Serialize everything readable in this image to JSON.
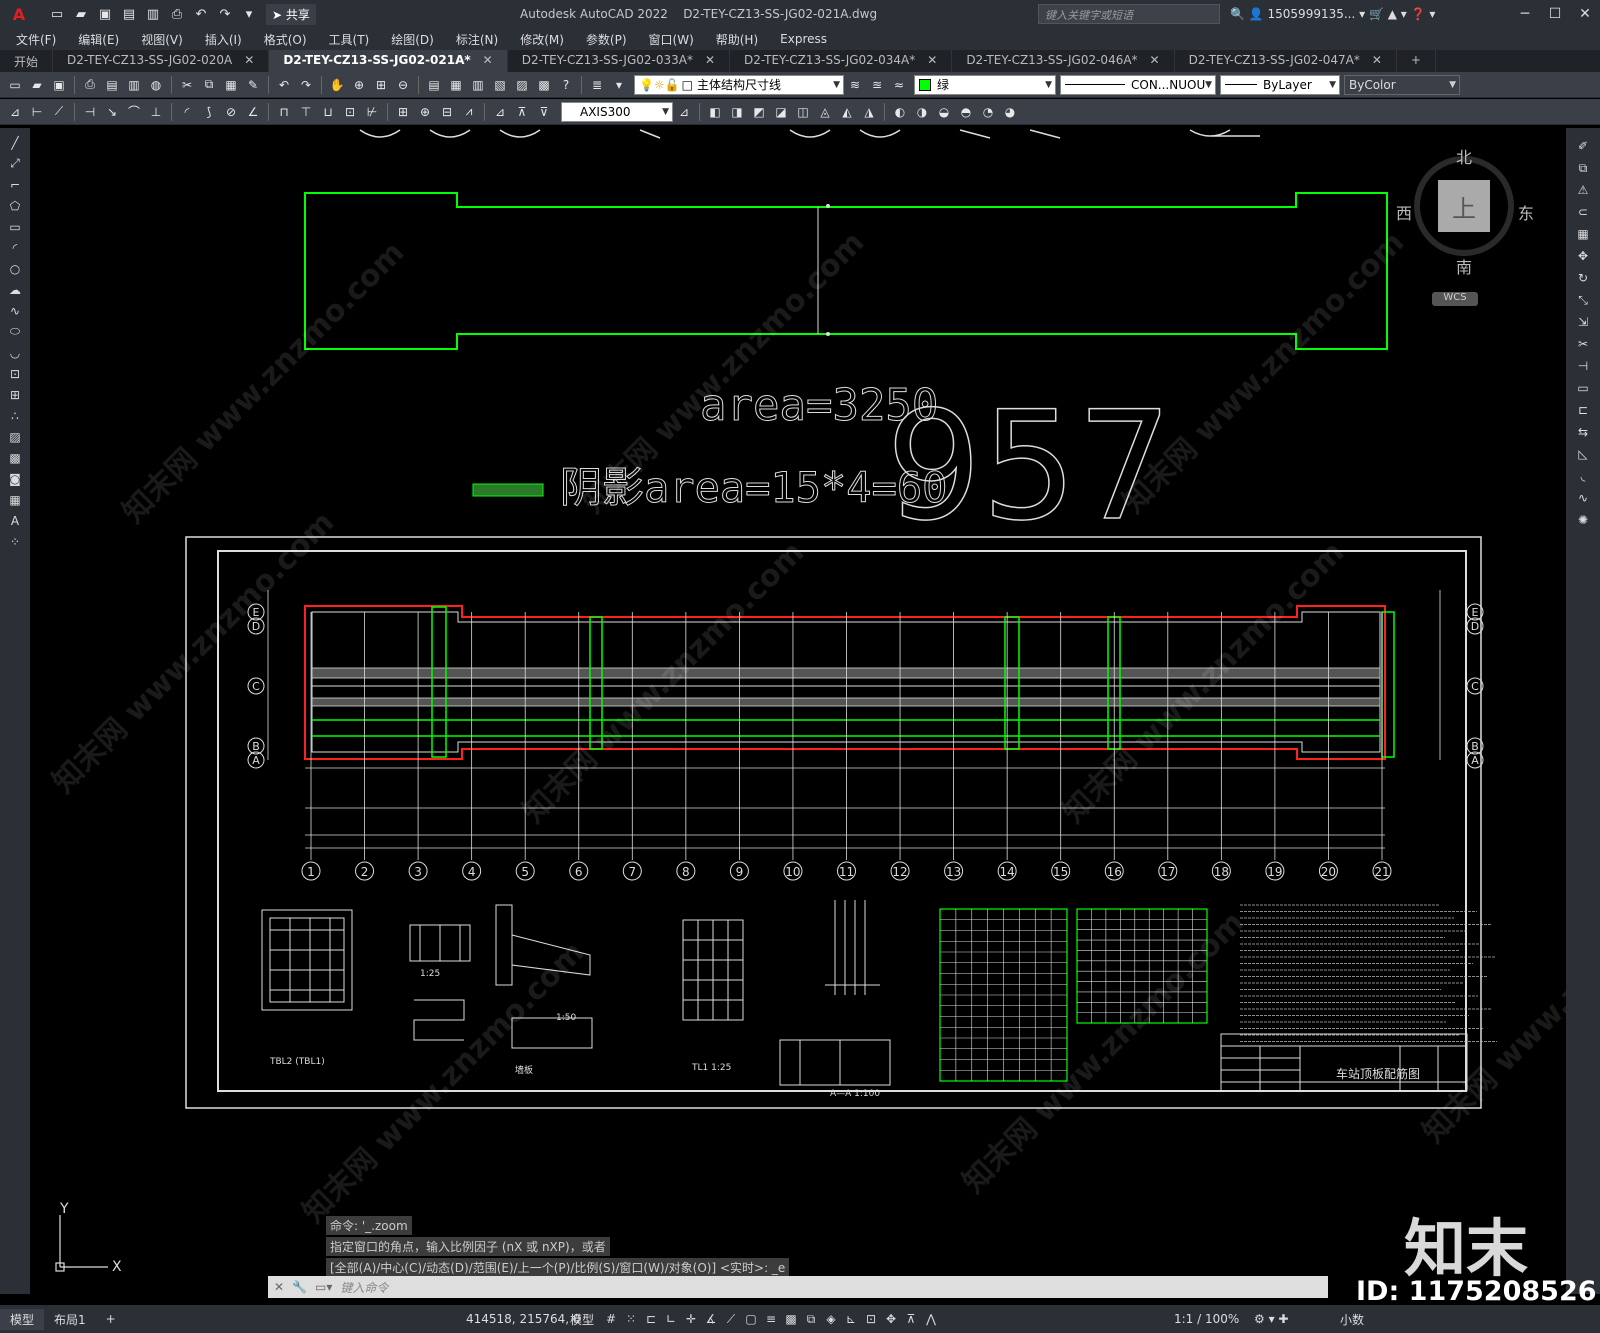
{
  "titlebar": {
    "logo": "A",
    "share_label": "共享",
    "app_title": "Autodesk AutoCAD 2022",
    "file_title": "D2-TEY-CZ13-SS-JG02-021A.dwg",
    "search_placeholder": "键入关键字或短语",
    "user": "1505999135..."
  },
  "menu": [
    "文件(F)",
    "编辑(E)",
    "视图(V)",
    "插入(I)",
    "格式(O)",
    "工具(T)",
    "绘图(D)",
    "标注(N)",
    "修改(M)",
    "参数(P)",
    "窗口(W)",
    "帮助(H)",
    "Express"
  ],
  "tabs": [
    {
      "label": "开始",
      "active": false,
      "closable": false
    },
    {
      "label": "D2-TEY-CZ13-SS-JG02-020A",
      "active": false,
      "closable": true
    },
    {
      "label": "D2-TEY-CZ13-SS-JG02-021A*",
      "active": true,
      "closable": true
    },
    {
      "label": "D2-TEY-CZ13-SS-JG02-033A*",
      "active": false,
      "closable": true
    },
    {
      "label": "D2-TEY-CZ13-SS-JG02-034A*",
      "active": false,
      "closable": true
    },
    {
      "label": "D2-TEY-CZ13-SS-JG02-046A*",
      "active": false,
      "closable": true
    },
    {
      "label": "D2-TEY-CZ13-SS-JG02-047A*",
      "active": false,
      "closable": true
    }
  ],
  "toolbar": {
    "layer": "主体结构尺寸线",
    "color": "绿",
    "linetype": "CON...NUOU",
    "lineweight": "ByLayer",
    "plotstyle": "ByColor",
    "dimstyle": "AXIS300"
  },
  "viewcube": {
    "north": "北",
    "south": "南",
    "east": "东",
    "west": "西",
    "face": "上",
    "wcs": "WCS"
  },
  "drawing": {
    "area_text": "area=3250",
    "hatch_text": "阴影area=15*4=60",
    "big_number": "957",
    "sheet_title": "车站顶板配筋图",
    "grid_numbers": [
      "1",
      "2",
      "3",
      "4",
      "5",
      "6",
      "7",
      "8",
      "9",
      "10",
      "11",
      "12",
      "13",
      "14",
      "15",
      "16",
      "17",
      "18",
      "19",
      "20",
      "21"
    ],
    "grid_letters_left": [
      "E",
      "D",
      "C",
      "B",
      "A"
    ],
    "grid_letters_right": [
      "E",
      "D",
      "C",
      "B",
      "A"
    ]
  },
  "command": {
    "history": [
      "命令: '_.zoom",
      "指定窗口的角点，输入比例因子 (nX 或 nXP)，或者",
      "[全部(A)/中心(C)/动态(D)/范围(E)/上一个(P)/比例(S)/窗口(W)/对象(O)] <实时>: _e"
    ],
    "placeholder": "键入命令"
  },
  "status": {
    "layout_tabs": [
      "模型",
      "布局1"
    ],
    "coords": "414518, 215764, 0",
    "space": "模型",
    "scale": "1:1 / 100%",
    "units": "小数"
  },
  "brand": {
    "logo_text": "知末",
    "id_text": "ID: 1175208526"
  },
  "watermarks": [
    "知末网 www.znzmo.com"
  ],
  "colors": {
    "drawing_green": "#00ff00",
    "drawing_red": "#ff2020",
    "accent": "#2f6fd0"
  }
}
